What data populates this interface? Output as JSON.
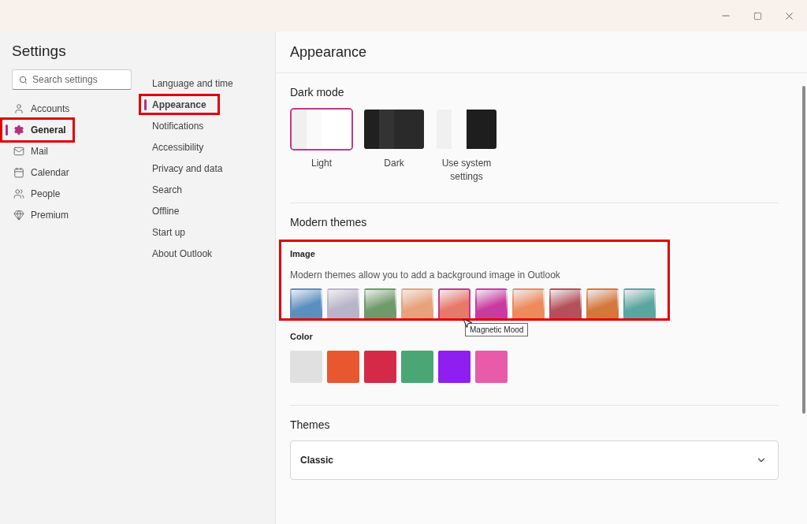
{
  "settings_title": "Settings",
  "search": {
    "placeholder": "Search settings"
  },
  "categories": [
    {
      "label": "Accounts",
      "selected": false,
      "highlighted": false
    },
    {
      "label": "General",
      "selected": true,
      "highlighted": true
    },
    {
      "label": "Mail",
      "selected": false,
      "highlighted": false
    },
    {
      "label": "Calendar",
      "selected": false,
      "highlighted": false
    },
    {
      "label": "People",
      "selected": false,
      "highlighted": false
    },
    {
      "label": "Premium",
      "selected": false,
      "highlighted": false
    }
  ],
  "subpages": [
    {
      "label": "Language and time",
      "selected": false,
      "highlighted": false
    },
    {
      "label": "Appearance",
      "selected": true,
      "highlighted": true
    },
    {
      "label": "Notifications",
      "selected": false,
      "highlighted": false
    },
    {
      "label": "Accessibility",
      "selected": false,
      "highlighted": false
    },
    {
      "label": "Privacy and data",
      "selected": false,
      "highlighted": false
    },
    {
      "label": "Search",
      "selected": false,
      "highlighted": false
    },
    {
      "label": "Offline",
      "selected": false,
      "highlighted": false
    },
    {
      "label": "Start up",
      "selected": false,
      "highlighted": false
    },
    {
      "label": "About Outlook",
      "selected": false,
      "highlighted": false
    }
  ],
  "page_title": "Appearance",
  "dark_mode": {
    "title": "Dark mode",
    "options": [
      {
        "label": "Light",
        "kind": "light",
        "selected": true
      },
      {
        "label": "Dark",
        "kind": "dark",
        "selected": false
      },
      {
        "label": "Use system settings",
        "kind": "system",
        "selected": false
      }
    ]
  },
  "modern_themes": {
    "title": "Modern themes",
    "image": {
      "title": "Image",
      "description": "Modern themes allow you to add a background image in Outlook",
      "highlighted": true,
      "images": [
        {
          "color": "#5b8fbf",
          "selected": false
        },
        {
          "color": "#b9b4c8",
          "selected": false
        },
        {
          "color": "#6f9a6a",
          "selected": false
        },
        {
          "color": "#e8a27a",
          "selected": false
        },
        {
          "color": "#e8786a",
          "selected": true
        },
        {
          "color": "#c93aa0",
          "selected": false
        },
        {
          "color": "#ee8a5c",
          "selected": false
        },
        {
          "color": "#b5505a",
          "selected": false
        },
        {
          "color": "#d4783c",
          "selected": false
        },
        {
          "color": "#5aa6a0",
          "selected": false
        }
      ],
      "tooltip": "Magnetic Mood"
    },
    "color": {
      "title": "Color",
      "swatches": [
        {
          "color": "#e0e0e0",
          "selected": false
        },
        {
          "color": "#e8572f",
          "selected": false
        },
        {
          "color": "#d42a48",
          "selected": false
        },
        {
          "color": "#4aa775",
          "selected": false
        },
        {
          "color": "#8f1ff0",
          "selected": false
        },
        {
          "color": "#e85ba8",
          "selected": false
        }
      ]
    }
  },
  "themes": {
    "title": "Themes",
    "value": "Classic"
  }
}
